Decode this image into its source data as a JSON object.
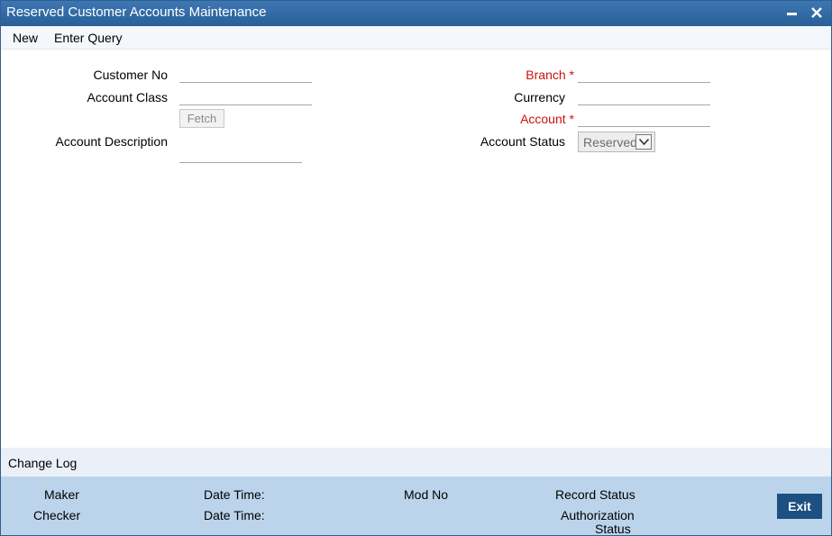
{
  "window": {
    "title": "Reserved Customer Accounts Maintenance"
  },
  "menu": {
    "new": "New",
    "enter_query": "Enter Query"
  },
  "form": {
    "customer_no_label": "Customer No",
    "account_class_label": "Account Class",
    "fetch_label": "Fetch",
    "account_description_label": "Account Description",
    "branch_label": "Branch",
    "currency_label": "Currency",
    "account_label": "Account",
    "required_mark": "*",
    "account_status_label": "Account Status",
    "account_status_value": "Reserved",
    "customer_no_value": "",
    "account_class_value": "",
    "account_description_value": "",
    "branch_value": "",
    "currency_value": "",
    "account_value": ""
  },
  "change_log": {
    "label": "Change Log"
  },
  "audit": {
    "maker": "Maker",
    "checker": "Checker",
    "date_time_1": "Date Time:",
    "date_time_2": "Date Time:",
    "mod_no": "Mod No",
    "record_status": "Record Status",
    "authorization": "Authorization",
    "status": "Status"
  },
  "buttons": {
    "exit": "Exit"
  },
  "colors": {
    "titlebar": "#2a5f98",
    "required": "#cc1111",
    "footer": "#bcd4eb",
    "exit_button": "#1d4f80"
  }
}
